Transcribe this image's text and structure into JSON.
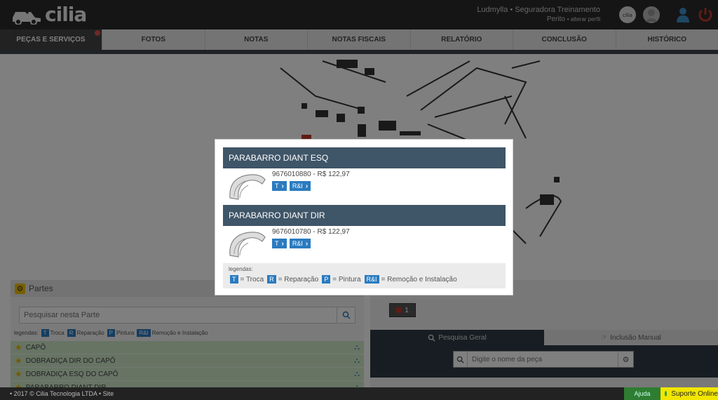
{
  "app": {
    "logo_text": "cilia",
    "user_name": "Ludmylla • Seguradora Treinamento",
    "user_role": "Perito",
    "user_role_link": "• alterar perfil"
  },
  "tabs": [
    {
      "label": "PEÇAS E SERVIÇOS"
    },
    {
      "label": "FOTOS"
    },
    {
      "label": "NOTAS"
    },
    {
      "label": "NOTAS FISCAIS"
    },
    {
      "label": "RELATÓRIO"
    },
    {
      "label": "CONCLUSÃO"
    },
    {
      "label": "HISTÓRICO"
    }
  ],
  "partes": {
    "title": "Partes",
    "search_placeholder": "Pesquisar nesta Parte",
    "legend_label": "legendas:",
    "legend": [
      {
        "code": "T",
        "text": "Troca"
      },
      {
        "code": "R",
        "text": "Reparação"
      },
      {
        "code": "P",
        "text": "Pintura"
      },
      {
        "code": "R&I",
        "text": "Remoção e Instalação"
      }
    ],
    "items": [
      "CAPÔ",
      "DOBRADIÇA DIR DO CAPÔ",
      "DOBRADIÇA ESQ DO CAPÔ",
      "PARABARRO DIANT DIR"
    ]
  },
  "right": {
    "counter": "1",
    "tab_search": "Pesquisa Geral",
    "tab_manual": "Inclusão Manual",
    "search_placeholder": "Digite o nome da peça"
  },
  "modal": {
    "items": [
      {
        "title": "PARABARRO DIANT ESQ",
        "code_price": "9676010880 - R$ 122,97",
        "btn_t": "T",
        "btn_ri": "R&I"
      },
      {
        "title": "PARABARRO DIANT DIR",
        "code_price": "9676010780 - R$ 122,97",
        "btn_t": "T",
        "btn_ri": "R&I"
      }
    ],
    "legend_label": "legendas:",
    "legend": [
      {
        "code": "T",
        "text": "= Troca"
      },
      {
        "code": "R",
        "text": "= Reparação"
      },
      {
        "code": "P",
        "text": "= Pintura"
      },
      {
        "code": "R&I",
        "text": "= Remoção e Instalação"
      }
    ]
  },
  "footer": {
    "copyright": "• 2017 © Cilia Tecnologia LTDA • Site",
    "ajuda": "Ajuda",
    "suporte": "Suporte Online"
  },
  "colors": {
    "accent": "#2a7bc0",
    "modal_header": "#3f5568",
    "topbar": "#2b2b2b"
  }
}
